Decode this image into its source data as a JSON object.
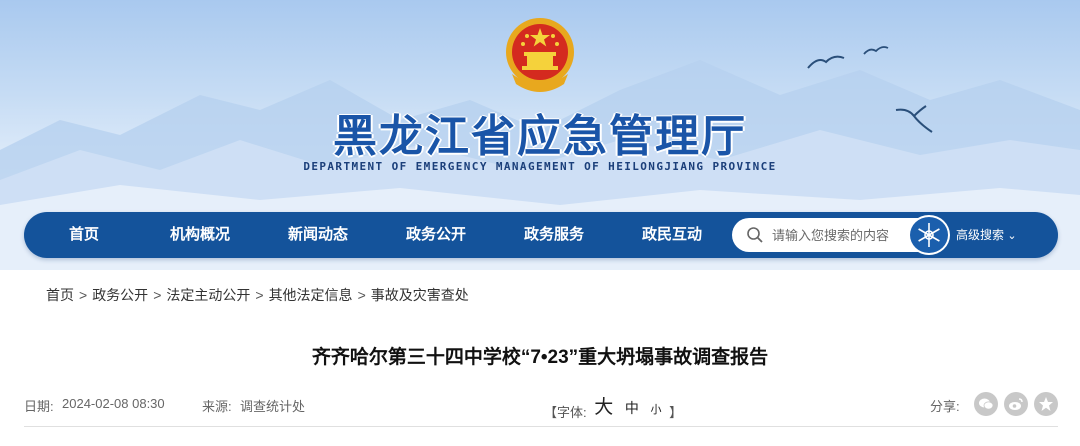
{
  "header": {
    "site_title": "黑龙江省应急管理厅",
    "site_subtitle": "DEPARTMENT OF EMERGENCY MANAGEMENT OF HEILONGJIANG PROVINCE"
  },
  "nav": {
    "items": [
      {
        "label": "首页"
      },
      {
        "label": "机构概况"
      },
      {
        "label": "新闻动态"
      },
      {
        "label": "政务公开"
      },
      {
        "label": "政务服务"
      },
      {
        "label": "政民互动"
      }
    ],
    "search_placeholder": "请输入您搜索的内容",
    "advanced_search": "高级搜索",
    "chevron": "⌄"
  },
  "breadcrumb": {
    "items": [
      "首页",
      "政务公开",
      "法定主动公开",
      "其他法定信息",
      "事故及灾害查处"
    ],
    "separator": ">"
  },
  "article": {
    "title": "齐齐哈尔第三十四中学校“7•23”重大坍塌事故调查报告",
    "date_label": "日期:",
    "date": "2024-02-08 08:30",
    "source_label": "来源:",
    "source": "调查统计处",
    "font_label_open": "【字体:",
    "font_large": "大",
    "font_medium": "中",
    "font_small": "小",
    "font_label_close": "】",
    "share_label": "分享:"
  },
  "icons": {
    "emblem": "national-emblem-icon",
    "search": "search-icon",
    "share": [
      "wechat-icon",
      "weibo-icon",
      "star-icon"
    ]
  },
  "colors": {
    "nav_bg": "#14539b",
    "title_blue": "#1a55a8",
    "share_gray": "#c8c8c8"
  }
}
